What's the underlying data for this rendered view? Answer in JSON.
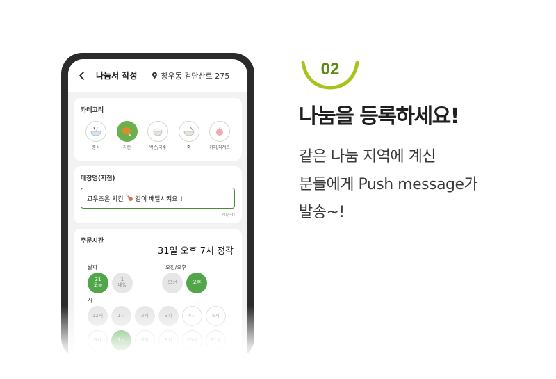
{
  "app": {
    "header": {
      "title": "나눔서 작성",
      "location": "창우동 검단산로 275"
    },
    "category": {
      "label": "카테고리",
      "items": [
        {
          "label": "중식",
          "icon": "noodle-bowl-icon",
          "selected": false
        },
        {
          "label": "치킨",
          "icon": "chicken-icon",
          "selected": true
        },
        {
          "label": "백반/국수",
          "icon": "rice-bowl-icon",
          "selected": false
        },
        {
          "label": "죽",
          "icon": "porridge-icon",
          "selected": false
        },
        {
          "label": "커피/디저트",
          "icon": "dessert-icon",
          "selected": false
        }
      ]
    },
    "store": {
      "label": "매장명(지점)",
      "value_before": "교우초온 치킨",
      "value_after": "같이 배달시켜요!!",
      "counter": "20/30"
    },
    "order_time": {
      "label": "주문시간",
      "summary": "31일 오후 7시 정각",
      "date_label": "날짜",
      "ampm_label": "오전/오후",
      "dates": [
        {
          "line1": "31",
          "line2": "오늘",
          "selected": true
        },
        {
          "line1": "1",
          "line2": "내일",
          "selected": false
        }
      ],
      "ampm": [
        {
          "label": "오전",
          "selected": false
        },
        {
          "label": "오후",
          "selected": true
        }
      ],
      "hour_label": "시",
      "hours_row1": [
        "12시",
        "1시",
        "2시",
        "3시",
        "4시",
        "5시"
      ],
      "hours_row2": [
        "6시",
        "7시",
        "8시",
        "9시",
        "10시",
        "11시"
      ],
      "selected_hour": "7시"
    }
  },
  "promo": {
    "step": "02",
    "headline": "나눔을 등록하세요!",
    "desc_line1": "같은 나눔 지역에 계신",
    "desc_line2": "분들에게 Push message가",
    "desc_line3": "발송~!"
  },
  "colors": {
    "accent_green": "#52a64a",
    "step_green": "#5e8a14",
    "arc_green": "#a8c41c",
    "phone_frame": "#2b2b2b"
  }
}
